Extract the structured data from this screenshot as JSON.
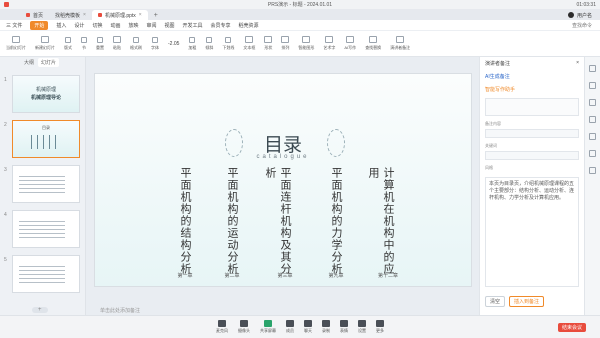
{
  "window": {
    "title": "PRS演示 - 标题 - 2024.01.01",
    "time": "01:03:31"
  },
  "tabs": [
    {
      "label": "首页"
    },
    {
      "label": "找稻壳模板"
    },
    {
      "label": "机械原理.pptx"
    }
  ],
  "user": {
    "name": "用户名"
  },
  "menubar": {
    "items": [
      "三 文件",
      "开始",
      "插入",
      "设计",
      "切换",
      "动画",
      "放映",
      "审阅",
      "视图",
      "开发工具",
      "会员专享",
      "稻壳资源"
    ],
    "search": "查找命令"
  },
  "toolbar": {
    "items": [
      "当前幻灯片",
      "新建幻灯片",
      "版式",
      "节",
      "重置",
      "粘贴",
      "格式刷",
      "字体",
      "字号",
      "加粗",
      "倾斜",
      "下划线",
      "文本框",
      "形状",
      "排列",
      "智能图形",
      "艺术字",
      "AI写作",
      "查找替换",
      "演讲者备注"
    ],
    "zoom": "-2.05"
  },
  "leftpanel": {
    "tabs": [
      "大纲",
      "幻灯片"
    ],
    "slides": [
      {
        "num": "1",
        "t1": "机械原理",
        "t2": "机械原理导论"
      },
      {
        "num": "2",
        "t1": "目录"
      },
      {
        "num": "3",
        "t1": ""
      },
      {
        "num": "4",
        "t1": ""
      },
      {
        "num": "5",
        "t1": ""
      }
    ],
    "add": "+"
  },
  "slide": {
    "title": "目录",
    "subtitle": "catalogue",
    "columns": [
      "平面机构的结构分析",
      "平面机构的运动分析",
      "平面连杆机构及其分析",
      "平面机构的力学分析",
      "计算机在机构中的应用"
    ],
    "chapters": [
      "第一章",
      "第二章",
      "第三章",
      "第九章",
      "第十二章"
    ]
  },
  "notes": "单击此处添加备注",
  "rightpanel": {
    "header": "演讲者备注",
    "link1": "AI生成备注",
    "link2": "智能写作助手",
    "label1": "备注内容",
    "label2": "关键词",
    "label3": "风格",
    "text": "本页为目录页，介绍机械原理课程的五个主要部分：结构分析、运动分析、连杆机构、力学分析及计算机应用。",
    "btn1": "清空",
    "btn2": "插入到备注"
  },
  "dock": {
    "items": [
      "麦克风",
      "摄像头",
      "共享屏幕",
      "成员",
      "聊天",
      "录制",
      "表情",
      "设置",
      "更多"
    ],
    "end": "结束会议"
  }
}
